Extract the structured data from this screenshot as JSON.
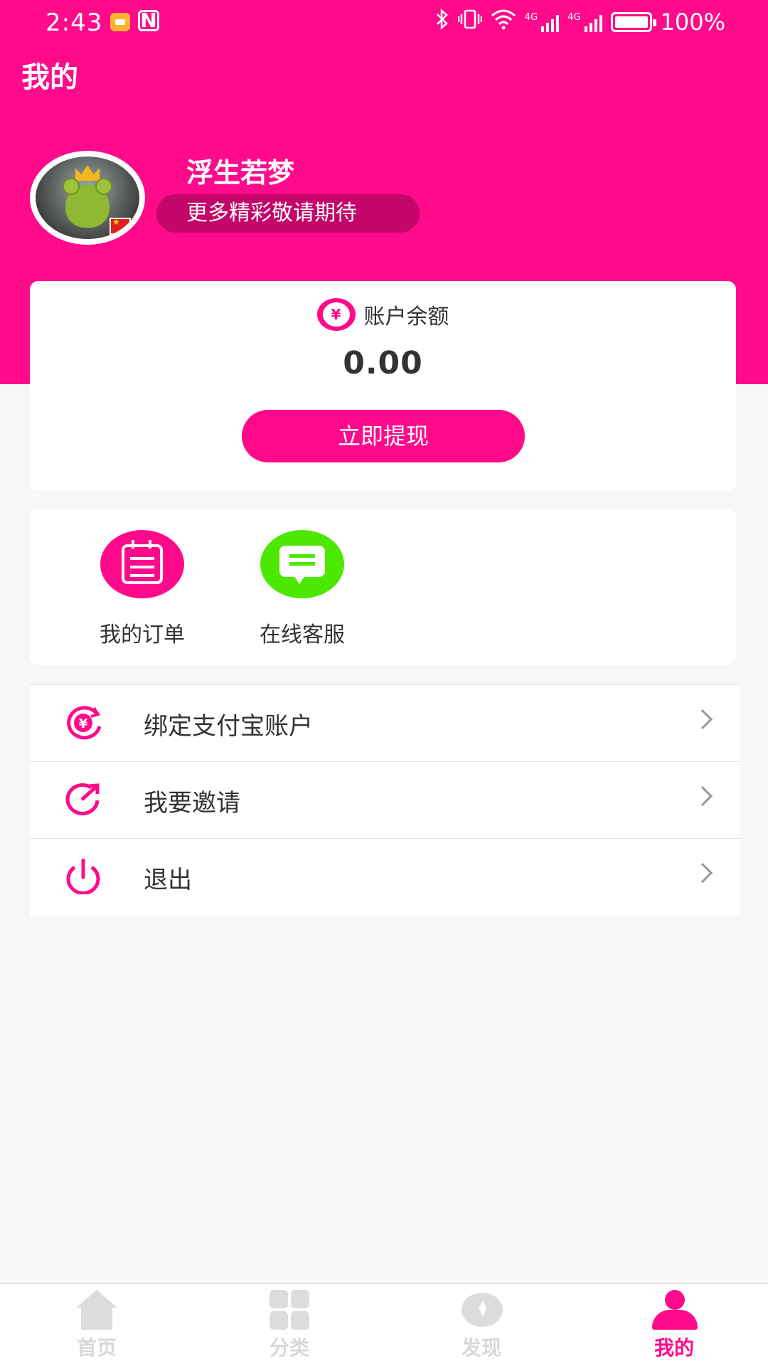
{
  "status_bar": {
    "time": "2:43",
    "nfc": "N",
    "battery": "100%"
  },
  "header": {
    "title": "我的"
  },
  "profile": {
    "username": "浮生若梦",
    "tagline": "更多精彩敬请期待"
  },
  "balance": {
    "icon_symbol": "¥",
    "label": "账户余额",
    "value": "0.00",
    "withdraw_label": "立即提现"
  },
  "shortcuts": [
    {
      "label": "我的订单",
      "icon": "clipboard-icon",
      "color": "#ff0a8b"
    },
    {
      "label": "在线客服",
      "icon": "chat-bubble-icon",
      "color": "#4de800"
    }
  ],
  "menu": [
    {
      "label": "绑定支付宝账户",
      "icon": "yen-refresh-icon"
    },
    {
      "label": "我要邀请",
      "icon": "share-icon"
    },
    {
      "label": "退出",
      "icon": "power-icon"
    }
  ],
  "tabbar": [
    {
      "label": "首页",
      "icon": "home-icon",
      "active": false
    },
    {
      "label": "分类",
      "icon": "grid-icon",
      "active": false
    },
    {
      "label": "发现",
      "icon": "compass-icon",
      "active": false
    },
    {
      "label": "我的",
      "icon": "user-icon",
      "active": true
    }
  ],
  "colors": {
    "brand": "#ff0a8b",
    "service_green": "#4de800",
    "background": "#f7f7f7"
  }
}
